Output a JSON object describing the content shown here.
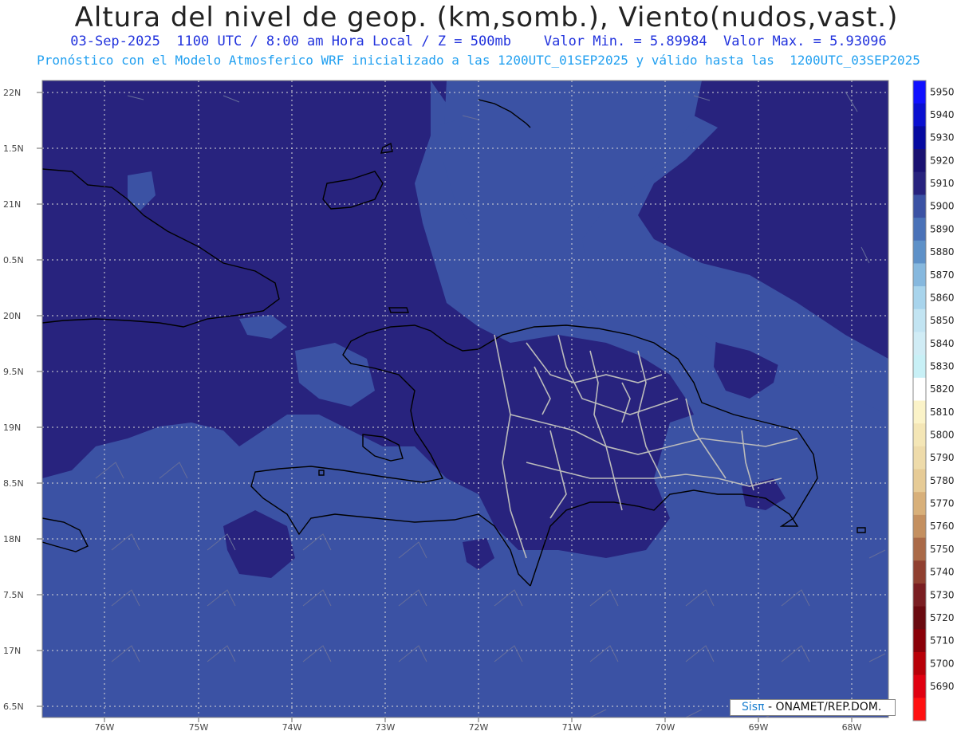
{
  "header": {
    "title": "Altura del nivel de geop. (km,somb.), Viento(nudos,vast.)",
    "subtitle_line1": "03-Sep-2025  1100 UTC / 8:00 am Hora Local / Z = 500mb    Valor Min. = 5.89984  Valor Max. = 5.93096",
    "subtitle_line2": "Pronóstico con el Modelo Atmosferico WRF inicializado a las 1200UTC_01SEP2025 y válido hasta las  1200UTC_03SEP2025"
  },
  "map": {
    "lat_labels": [
      "22N",
      "1.5N",
      "21N",
      "0.5N",
      "20N",
      "9.5N",
      "19N",
      "8.5N",
      "18N",
      "7.5N",
      "17N",
      "6.5N"
    ],
    "lon_labels": [
      "76W",
      "75W",
      "74W",
      "73W",
      "72W",
      "71W",
      "70W",
      "69W",
      "68W"
    ],
    "colors": {
      "field_low": "#3b52a4",
      "field_high": "#28237e",
      "coast": "#000000",
      "borders": "#bbbbbb",
      "grid": "#cfcfcf"
    }
  },
  "colorbar": {
    "levels": [
      {
        "label": "5950",
        "color": "#1010ff"
      },
      {
        "label": "5940",
        "color": "#0a10d0"
      },
      {
        "label": "5930",
        "color": "#060aa0"
      },
      {
        "label": "5920",
        "color": "#1a1272"
      },
      {
        "label": "5910",
        "color": "#28237e"
      },
      {
        "label": "5900",
        "color": "#3b52a4"
      },
      {
        "label": "5890",
        "color": "#4a72b8"
      },
      {
        "label": "5880",
        "color": "#5e91c8"
      },
      {
        "label": "5870",
        "color": "#86b8de"
      },
      {
        "label": "5860",
        "color": "#a8d4ec"
      },
      {
        "label": "5850",
        "color": "#c2e4f2"
      },
      {
        "label": "5840",
        "color": "#d0ecf5"
      },
      {
        "label": "5830",
        "color": "#c8f0f6"
      },
      {
        "label": "5820",
        "color": "#ffffff"
      },
      {
        "label": "5810",
        "color": "#fbf3c8"
      },
      {
        "label": "5800",
        "color": "#f4e6b6"
      },
      {
        "label": "5790",
        "color": "#eedbaa"
      },
      {
        "label": "5780",
        "color": "#e6cb96"
      },
      {
        "label": "5770",
        "color": "#d8b07a"
      },
      {
        "label": "5760",
        "color": "#c49060"
      },
      {
        "label": "5750",
        "color": "#aa6a48"
      },
      {
        "label": "5740",
        "color": "#904030"
      },
      {
        "label": "5730",
        "color": "#7a1e22"
      },
      {
        "label": "5720",
        "color": "#6a0a10"
      },
      {
        "label": "5710",
        "color": "#8a0008"
      },
      {
        "label": "5700",
        "color": "#b80008"
      },
      {
        "label": "5690",
        "color": "#e00010"
      },
      {
        "label": "",
        "color": "#ff1010"
      }
    ]
  },
  "credit": {
    "sis": "Sisπ",
    "text": " - ONAMET/REP.DOM."
  }
}
